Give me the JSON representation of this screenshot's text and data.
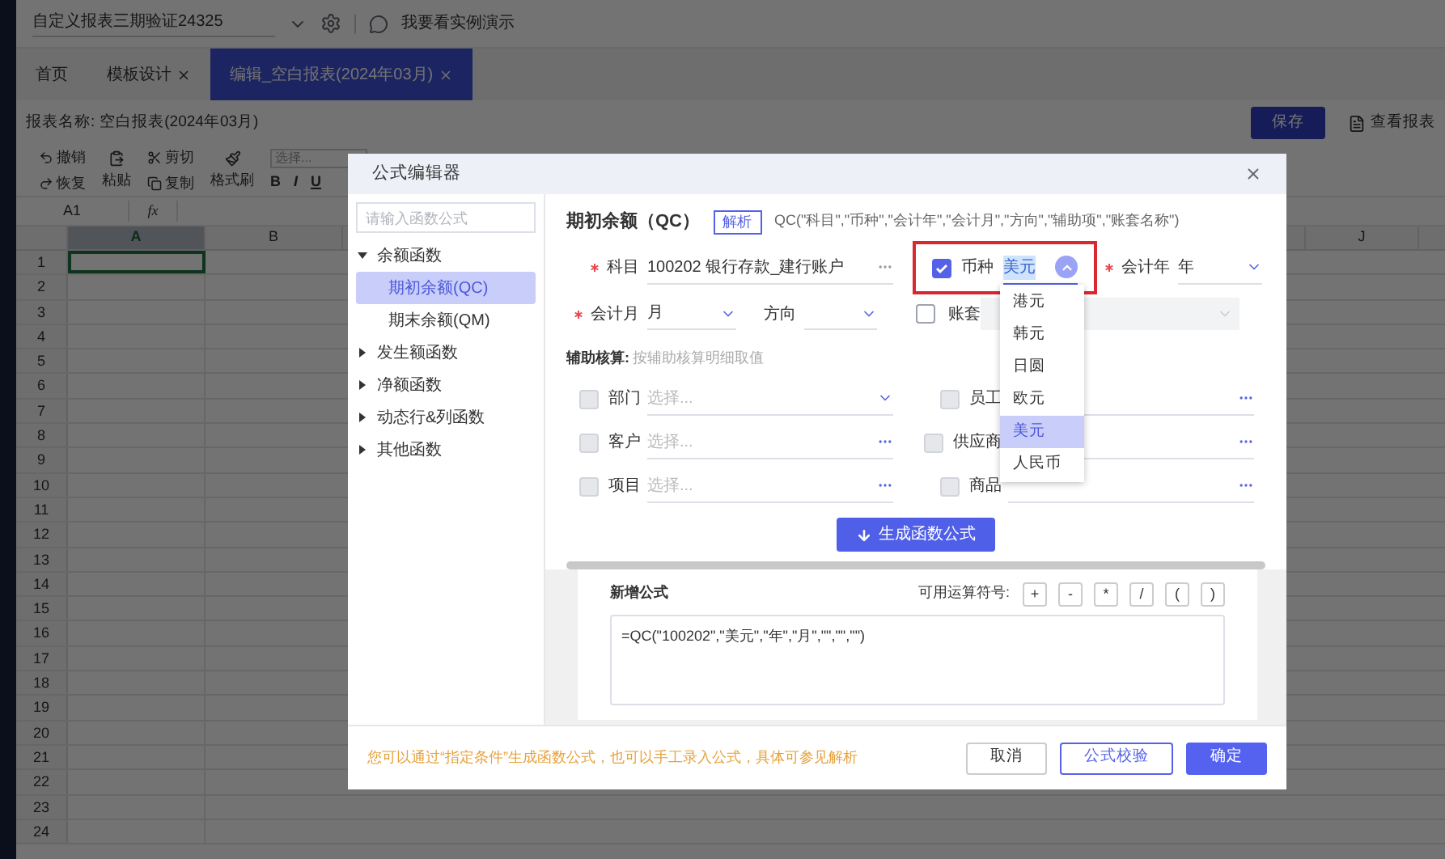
{
  "app": {
    "report_selector": "自定义报表三期验证24325",
    "demo_link": "我要看实例演示",
    "tabs": [
      {
        "label": "首页",
        "closable": false,
        "selected": false
      },
      {
        "label": "模板设计",
        "closable": true,
        "selected": false
      },
      {
        "label": "编辑_空白报表(2024年03月)",
        "closable": true,
        "selected": true
      }
    ],
    "report_name_label": "报表名称:",
    "report_name": "空白报表(2024年03月)",
    "save_button": "保存",
    "view_report": "查看报表",
    "toolbar": {
      "undo": "撤销",
      "redo": "恢复",
      "paste": "粘贴",
      "cut": "剪切",
      "copy": "复制",
      "format_painter": "格式刷",
      "font_placeholder": "选择...",
      "bold": "B",
      "italic": "I",
      "underline": "U"
    },
    "cell_ref": "A1",
    "fx": "fx",
    "columns": [
      {
        "label": "A",
        "selected": true
      },
      {
        "label": "B",
        "selected": false
      },
      {
        "label": "J",
        "selected": false
      }
    ],
    "rows": [
      "1",
      "2",
      "3",
      "4",
      "5",
      "6",
      "7",
      "8",
      "9",
      "10",
      "11",
      "12",
      "13",
      "14",
      "15",
      "16",
      "17",
      "18",
      "19",
      "20",
      "21",
      "22",
      "23",
      "24"
    ]
  },
  "dialog": {
    "title": "公式编辑器",
    "search": {
      "placeholder": "请输入函数公式"
    },
    "tree": [
      {
        "label": "余额函数",
        "expanded": true,
        "children": [
          {
            "label": "期初余额(QC)",
            "selected": true
          },
          {
            "label": "期末余额(QM)",
            "selected": false
          }
        ]
      },
      {
        "label": "发生额函数",
        "expanded": false
      },
      {
        "label": "净额函数",
        "expanded": false
      },
      {
        "label": "动态行&列函数",
        "expanded": false
      },
      {
        "label": "其他函数",
        "expanded": false
      }
    ],
    "function_title": "期初余额（QC）",
    "parse_button": "解析",
    "signature": "QC(\"科目\",\"币种\",\"会计年\",\"会计月\",\"方向\",\"辅助项\",\"账套名称\")",
    "subject": {
      "label": "科目",
      "required": true,
      "value": "100202 银行存款_建行账户"
    },
    "currency": {
      "label": "币种",
      "checked": true,
      "highlighted": true,
      "value": "美元",
      "expanded": true,
      "options": [
        {
          "label": "港元",
          "selected": false
        },
        {
          "label": "韩元",
          "selected": false
        },
        {
          "label": "日圆",
          "selected": false
        },
        {
          "label": "欧元",
          "selected": false
        },
        {
          "label": "美元",
          "selected": true
        },
        {
          "label": "人民币",
          "selected": false
        }
      ]
    },
    "year": {
      "label": "会计年",
      "required": true,
      "value": "年"
    },
    "month": {
      "label": "会计月",
      "required": true,
      "value": "月"
    },
    "direction": {
      "label": "方向"
    },
    "ledger": {
      "label": "账套",
      "checked": false,
      "disabled": true
    },
    "aux_title": "辅助核算:",
    "aux_hint": "按辅助核算明细取值",
    "auxiliary": [
      {
        "label": "部门",
        "kind": "select",
        "placeholder": "选择...",
        "checked": false,
        "disabled": true
      },
      {
        "label": "员工",
        "kind": "lookup",
        "checked": false,
        "disabled": true
      },
      {
        "label": "客户",
        "kind": "lookup",
        "placeholder": "选择...",
        "checked": false,
        "disabled": true
      },
      {
        "label": "供应商",
        "kind": "lookup",
        "checked": false,
        "disabled": true
      },
      {
        "label": "项目",
        "kind": "lookup",
        "placeholder": "选择...",
        "checked": false,
        "disabled": true
      },
      {
        "label": "商品",
        "kind": "lookup",
        "checked": false,
        "disabled": true
      }
    ],
    "generate_button": "生成函数公式",
    "new_formula_title": "新增公式",
    "operators_label": "可用运算符号:",
    "operators": [
      "+",
      "-",
      "*",
      "/",
      "(",
      ")"
    ],
    "formula": "=QC(\"100202\",\"美元\",\"年\",\"月\",\"\",\"\",\"\")",
    "hint": "您可以通过“指定条件”生成函数公式，也可以手工录入公式，具体可参见解析",
    "buttons": [
      {
        "label": "取消",
        "kind": "default"
      },
      {
        "label": "公式校验",
        "kind": "outline"
      },
      {
        "label": "确定",
        "kind": "primary"
      }
    ]
  }
}
